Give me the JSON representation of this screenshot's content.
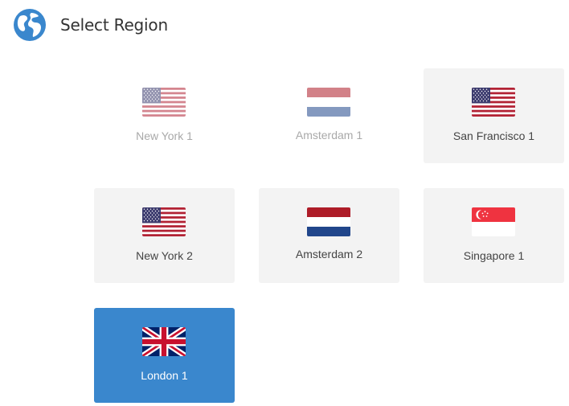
{
  "header": {
    "title": "Select Region",
    "icon": "globe-icon",
    "icon_color": "#3a87cd"
  },
  "regions": [
    {
      "label": "New York 1",
      "flag": "us-flag-icon",
      "state": "disabled"
    },
    {
      "label": "Amsterdam 1",
      "flag": "nl-flag-icon",
      "state": "disabled"
    },
    {
      "label": "San Francisco 1",
      "flag": "us-flag-icon",
      "state": "available"
    },
    {
      "label": "New York 2",
      "flag": "us-flag-icon",
      "state": "available"
    },
    {
      "label": "Amsterdam 2",
      "flag": "nl-flag-icon",
      "state": "available"
    },
    {
      "label": "Singapore 1",
      "flag": "sg-flag-icon",
      "state": "available"
    },
    {
      "label": "London 1",
      "flag": "uk-flag-icon",
      "state": "selected"
    }
  ],
  "colors": {
    "selected_bg": "#3a87cd",
    "card_bg": "#f3f3f3",
    "disabled_text": "#a9a9a9"
  }
}
